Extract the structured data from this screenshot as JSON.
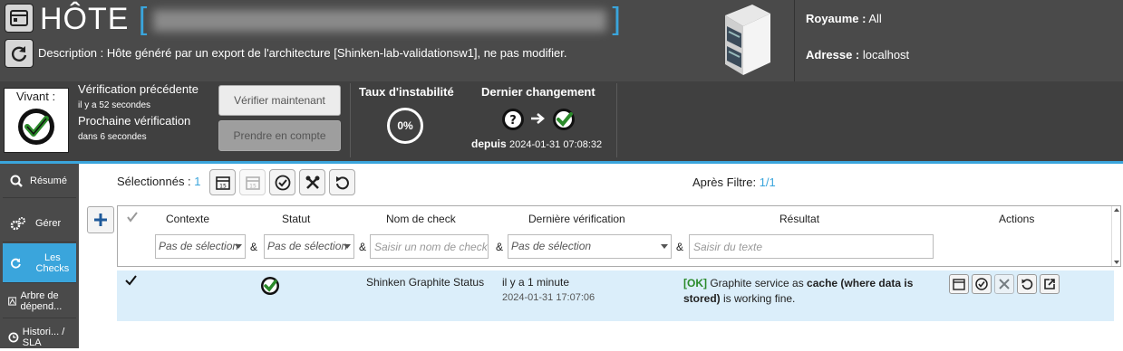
{
  "header": {
    "title": "HÔTE",
    "bracket_open": "[",
    "bracket_close": "]",
    "description": "Description : Hôte généré par un export de l'architecture [Shinken-lab-validationsw1], ne pas modifier.",
    "realm_label": "Royaume :",
    "realm_value": " All",
    "address_label": "Adresse :",
    "address_value": " localhost"
  },
  "status": {
    "alive_label": "Vivant :",
    "prev_check_label": "Vérification précédente",
    "prev_check_time": "il y a 52 secondes",
    "next_check_label": "Prochaine vérification",
    "next_check_time": "dans 6 secondes",
    "check_now_button": "Vérifier maintenant",
    "acknowledge_button": "Prendre en compte",
    "flapping_label": "Taux d'instabilité",
    "flapping_value": "0%",
    "last_change_label": "Dernier changement",
    "since_label": "depuis",
    "since_value": "2024-01-31 07:08:32"
  },
  "sidebar": {
    "items": [
      {
        "label": "Résumé",
        "icon": "search-icon"
      },
      {
        "label": "Gérer",
        "icon": "gears-icon"
      },
      {
        "label": "Les Checks",
        "icon": "refresh-icon"
      },
      {
        "label": "Arbre de dépend...",
        "icon": "tree-icon"
      },
      {
        "label": "Histori... / SLA",
        "icon": "clock-icon"
      }
    ]
  },
  "toolbar": {
    "selected_label": "Sélectionnés :",
    "selected_count": "1",
    "after_filter_label": "Après Filtre:",
    "after_filter_value": "1/1"
  },
  "table": {
    "headers": {
      "context": "Contexte",
      "status": "Statut",
      "check_name": "Nom de check",
      "last_check": "Dernière vérification",
      "result": "Résultat",
      "actions": "Actions"
    },
    "filters": {
      "context": "Pas de sélection",
      "status": "Pas de sélection",
      "check_name_placeholder": "Saisir un nom de check",
      "last_check": "Pas de sélection",
      "result_placeholder": "Saisir du texte",
      "amp": "&"
    },
    "rows": [
      {
        "check_name": "Shinken Graphite Status",
        "last_check_ago": "il y a 1 minute",
        "last_check_date": "2024-01-31 17:07:06",
        "result_ok": "[OK]",
        "result_text1": " Graphite service as ",
        "result_bold": "cache (where data is stored)",
        "result_text2": " is working fine."
      }
    ]
  },
  "colors": {
    "accent": "#3aa5dc",
    "ok": "#2a8a2a",
    "header_bg": "#4a4a4a",
    "row_bg": "#dbeefa"
  }
}
